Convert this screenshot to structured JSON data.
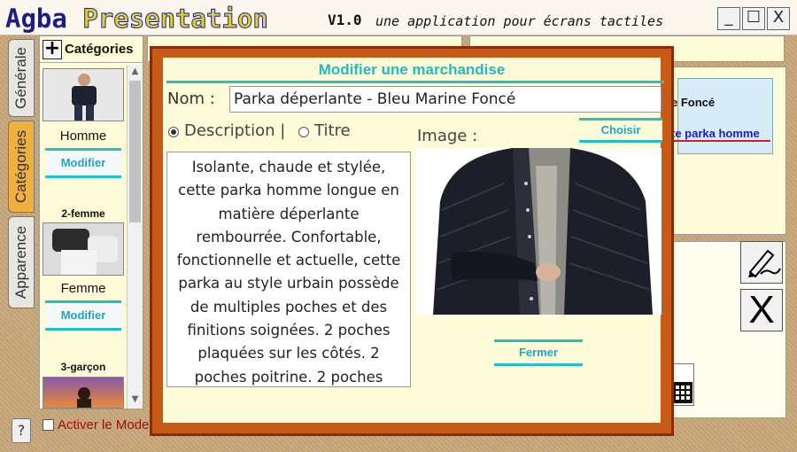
{
  "window": {
    "app_name_1": "Agba",
    "app_name_2": "Presentation",
    "version": "V1.0",
    "tagline": "une application pour écrans tactiles",
    "minimize": "_",
    "maximize": "☐",
    "close": "X"
  },
  "sidebar_tabs": [
    {
      "label": "Générale",
      "active": false
    },
    {
      "label": "Catégories",
      "active": true
    },
    {
      "label": "Apparence",
      "active": false
    }
  ],
  "help_label": "?",
  "categories": {
    "add_icon": "plus-icon",
    "header": "Catégories",
    "items": [
      {
        "number": "",
        "name": "Homme",
        "modify_label": "Modifier"
      },
      {
        "number": "2-femme",
        "name": "Femme",
        "modify_label": "Modifier"
      },
      {
        "number": "3-garçon",
        "name": "",
        "modify_label": ""
      }
    ]
  },
  "background": {
    "product_name_fragment": "e Foncé",
    "link_fragment": "te parka homme"
  },
  "activate_mode_label": "Activer le Mode",
  "modal": {
    "title": "Modifier une marchandise",
    "name_label": "Nom :",
    "name_value": "Parka déperlante - Bleu Marine Foncé",
    "radio_description": "Description |",
    "radio_title": "Titre",
    "selected_radio": "description",
    "image_label": "Image :",
    "choose_button": "Choisir",
    "description_text": "Isolante, chaude et stylée, cette parka homme longue en matière déperlante rembourrée. Confortable, fonctionnelle et actuelle, cette parka au style urbain possède de multiples poches et des finitions soignées.  2 poches plaquées sur les côtés. 2 poches poitrine. 2 poches",
    "close_button": "Fermer"
  },
  "colors": {
    "accent": "#22c1c3",
    "accent_text": "#1aa8c8",
    "modal_border": "#c85a18",
    "panel_bg": "#fefbd8",
    "active_tab": "#f0b040"
  }
}
